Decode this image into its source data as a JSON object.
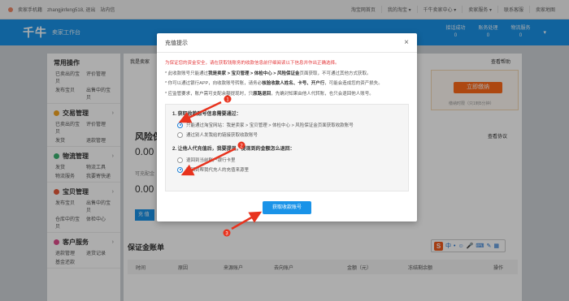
{
  "topbar": {
    "user_role": "卖家手机籍",
    "username": "zhangjinfeng518, 退出",
    "messages": "站内信",
    "links": [
      "淘宝网首页",
      "我的淘宝 ▾",
      "千牛卖家中心 ▾",
      "卖家服务 ▾",
      "联系客服",
      "卖家地图"
    ]
  },
  "header": {
    "logo": "千牛",
    "subtitle": "卖家工作台",
    "stats": [
      {
        "label": "接话成功",
        "value": "0"
      },
      {
        "label": "账务处理",
        "value": "0"
      },
      {
        "label": "物流服务",
        "value": "0"
      }
    ]
  },
  "sidebar": {
    "sections": [
      {
        "title": "常用操作",
        "links": [
          "已卖出的宝贝",
          "评价管理",
          "发布宝贝",
          "出售中的宝贝"
        ]
      },
      {
        "title": "交易管理",
        "links": [
          "已卖出的宝贝",
          "评价管理",
          "发货",
          "退款管理"
        ]
      },
      {
        "title": "物流管理",
        "links": [
          "发货",
          "物流工具",
          "物流服务",
          "我要寄快递"
        ]
      },
      {
        "title": "宝贝管理",
        "links": [
          "发布宝贝",
          "出售中的宝贝",
          "仓库中的宝贝",
          "体检中心"
        ]
      },
      {
        "title": "客户服务",
        "links": [
          "退款管理",
          "退货记录",
          "基金还款"
        ]
      }
    ]
  },
  "main": {
    "breadcrumb": "我是卖家",
    "help": "查看帮助",
    "recharge_button": "立即缴纳",
    "recharge_note": "缴纳时限（只1到5分钟）",
    "risk_title": "风险保",
    "risk_amount": "0.00",
    "risk_sub": "可充配金",
    "risk_amount2": "0.00",
    "blue_chip": "充 值",
    "set_alert": "查看协议",
    "ledger_title": "保证金账单",
    "ledger_columns": [
      "时间",
      "原因",
      "来源账户",
      "去向账户",
      "金额（元）",
      "冻结剩余额",
      "操作"
    ]
  },
  "ime": {
    "logo": "S",
    "items": [
      "中",
      "•",
      "☺",
      "🎤",
      "⌨",
      "✎",
      "▦"
    ]
  },
  "modal": {
    "title": "充值提示",
    "close": "×",
    "warning": "为保证您的资金安全，请在获取钱账务的收款信息前仔细阅读以下信息并作出正确选择。",
    "note1_prefix": "* 此收款账号只能通过",
    "note1_path": "我是卖家 > 宝贝管理 > 体检中心 > 风险保证金",
    "note1_suffix": "页面获取，不可通过其他方式获取。",
    "note2_prefix": "* 你可以通过银行APP，向收款账号转账，请务必",
    "note2_bold": "核验收款人姓名、卡号、开户行",
    "note2_suffix": "，可能会造成您的资产损失。",
    "note3_prefix": "* 应监管要求，账户需可支配余额提现时，只",
    "note3_bold": "原路退回",
    "note3_suffix": "，先确对知果由他人代转账，也只会退回他人账号。",
    "q1": "1. 获取收款账号信息需要通过：",
    "q1_options": [
      "只能通过淘宝网站：我是卖家 > 宝贝管理 > 体检中心 > 风险保证金页面获取收款账号",
      "通过别人发我给的链接获取收款账号"
    ],
    "q2": "2. 让他人代充值后，我要提现，提现到的金额怎么退回：",
    "q2_options": [
      "退回到当前账户银行卡里",
      "退回到帮我代充人的充值来源里"
    ],
    "confirm": "获取收款账号"
  },
  "annotations": [
    "1",
    "2",
    "3"
  ]
}
